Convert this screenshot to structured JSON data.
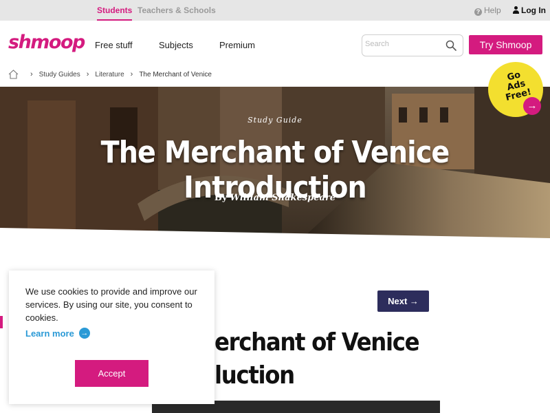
{
  "topbar": {
    "students": "Students",
    "teachers": "Teachers & Schools",
    "help": "Help",
    "login": "Log In"
  },
  "nav": {
    "logo": "shmoop",
    "links": [
      "Free stuff",
      "Subjects",
      "Premium"
    ],
    "search_placeholder": "Search",
    "try_button": "Try Shmoop"
  },
  "breadcrumb": {
    "items": [
      "Study Guides",
      "Literature",
      "The Merchant of Venice"
    ]
  },
  "hero": {
    "kicker": "Study Guide",
    "title": "The Merchant of Venice Introduction",
    "by": "By",
    "author": "William Shakespeare"
  },
  "badge": {
    "line1": "Go",
    "line2": "Ads Free!"
  },
  "content": {
    "next_label": "Next",
    "title_line1": "erchant of Venice",
    "title_line2": "luction"
  },
  "cookie": {
    "text": "We use cookies to provide and improve our services. By using our site, you consent to cookies.",
    "learn_more": "Learn more",
    "accept": "Accept"
  },
  "colors": {
    "brand": "#d41b7f",
    "navy": "#2d2d5c",
    "link_blue": "#2b9ad6",
    "badge_yellow": "#f3df2f"
  },
  "icons": [
    "help-icon",
    "person-icon",
    "search-icon",
    "home-icon",
    "chevron-right-icon",
    "arrow-right-icon"
  ]
}
